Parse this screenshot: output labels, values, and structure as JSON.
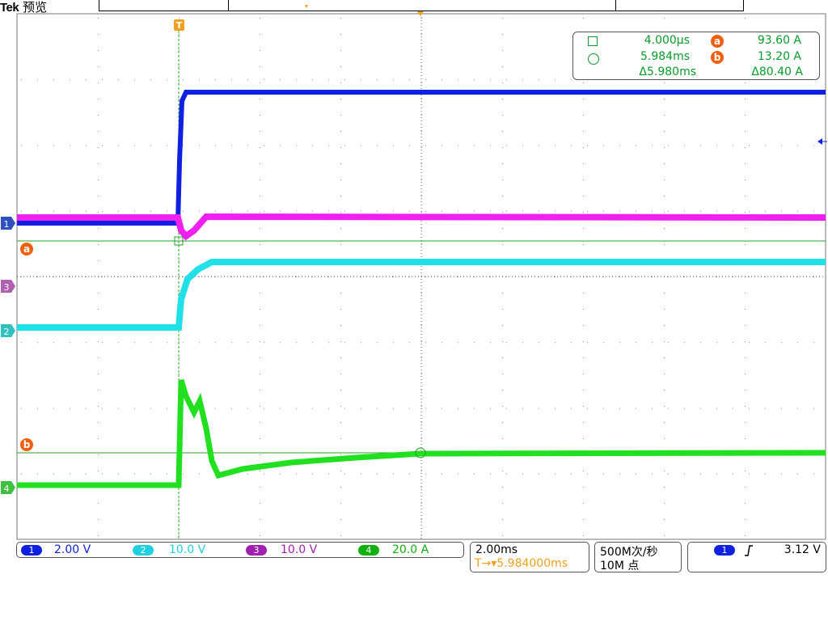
{
  "header": {
    "brand": "Tek",
    "mode": "预览"
  },
  "colors": {
    "ch1": "#1020e0",
    "ch2": "#20e0e8",
    "ch3": "#f020f0",
    "ch4": "#20e020",
    "cursor": "#0a9a2a",
    "marker": "#f06010",
    "trigger": "#f0a020"
  },
  "channel_markers": [
    {
      "label": "1",
      "color": "#3050c0"
    },
    {
      "label": "3",
      "color": "#b060b0"
    },
    {
      "label": "2",
      "color": "#30c0c0"
    },
    {
      "label": "4",
      "color": "#40c040"
    }
  ],
  "cursor_markers": {
    "a": "a",
    "b": "b"
  },
  "trigger_marker": "T",
  "cursor_readout": {
    "icon_a": "square-icon",
    "icon_b": "circle-icon",
    "time_a": "4.000μs",
    "time_b": "5.984ms",
    "time_delta": "Δ5.980ms",
    "amp_a_label": "a",
    "amp_a": "93.60 A",
    "amp_b_label": "b",
    "amp_b": "13.20 A",
    "amp_delta": "Δ80.40 A"
  },
  "status": {
    "channels": [
      {
        "num": "1",
        "scale": "2.00 V",
        "color": "#1020e0"
      },
      {
        "num": "2",
        "scale": "10.0 V",
        "color": "#20d0e0"
      },
      {
        "num": "3",
        "scale": "10.0 V",
        "color": "#a020b0"
      },
      {
        "num": "4",
        "scale": "20.0 A",
        "color": "#10b010"
      }
    ],
    "timebase": "2.00ms",
    "trigger_pos": "T→▾5.984000ms",
    "sample_rate": "500M次/秒",
    "record_length": "10M 点",
    "trigger_channel": "1",
    "trigger_slope_icon": "rising-edge-icon",
    "trigger_level": "3.12 V"
  }
}
